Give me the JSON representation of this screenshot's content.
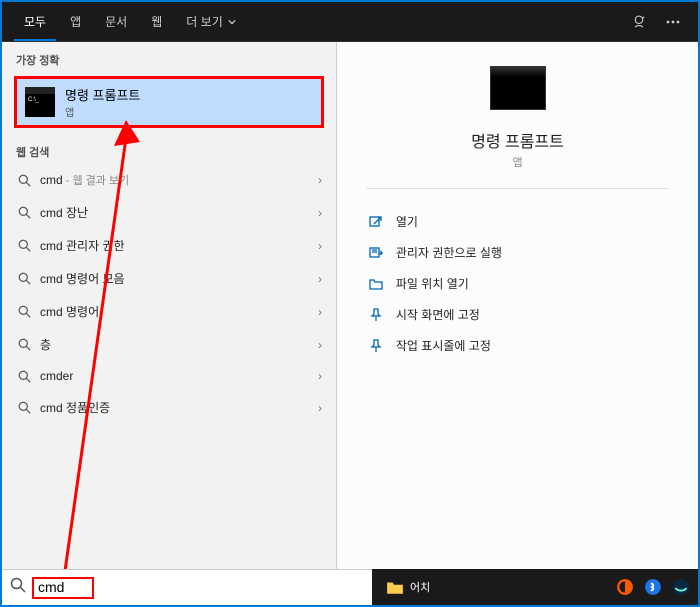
{
  "header": {
    "tabs": [
      {
        "label": "모두",
        "active": true
      },
      {
        "label": "앱"
      },
      {
        "label": "문서"
      },
      {
        "label": "웹"
      },
      {
        "label": "더 보기"
      }
    ]
  },
  "left": {
    "best_match_label": "가장 정확",
    "best_match": {
      "title": "명령 프롬프트",
      "subtitle": "앱"
    },
    "web_label": "웹 검색",
    "items": [
      {
        "text": "cmd",
        "sub": " - 웹 결과 보기"
      },
      {
        "text": "cmd 장난"
      },
      {
        "text": "cmd 관리자 권한"
      },
      {
        "text": "cmd 명령어 모음"
      },
      {
        "text": "cmd 명령어"
      },
      {
        "text": "층"
      },
      {
        "text": "cmder"
      },
      {
        "text": "cmd 정품인증"
      }
    ]
  },
  "right": {
    "title": "명령 프롬프트",
    "subtitle": "앱",
    "actions": [
      {
        "label": "열기",
        "icon": "open"
      },
      {
        "label": "관리자 권한으로 실행",
        "icon": "admin"
      },
      {
        "label": "파일 위치 열기",
        "icon": "folder"
      },
      {
        "label": "시작 화면에 고정",
        "icon": "pin-start"
      },
      {
        "label": "작업 표시줄에 고정",
        "icon": "pin-task"
      }
    ]
  },
  "search": {
    "value": "cmd"
  },
  "taskbar": {
    "item_label": "어치"
  }
}
